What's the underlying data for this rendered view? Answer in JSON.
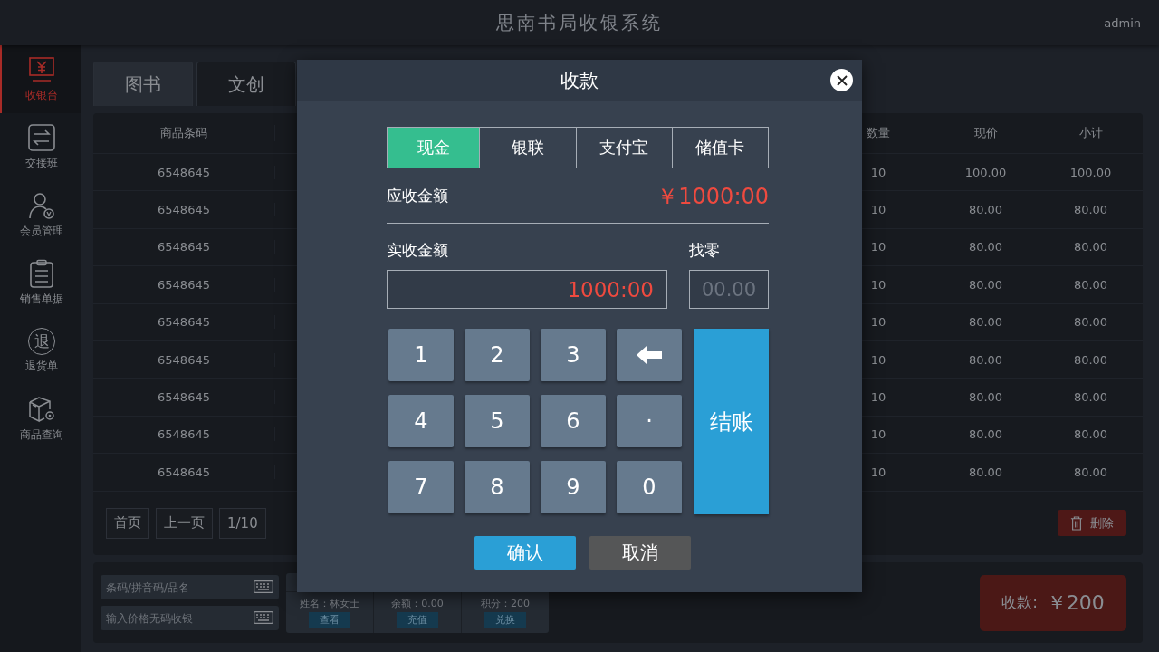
{
  "header": {
    "title": "思南书局收银系统",
    "user": "admin"
  },
  "sidebar": {
    "items": [
      {
        "label": "收银台",
        "selected": true
      },
      {
        "label": "交接班",
        "selected": false
      },
      {
        "label": "会员管理",
        "selected": false
      },
      {
        "label": "销售单据",
        "selected": false
      },
      {
        "label": "退货单",
        "icon_text": "退",
        "selected": false
      },
      {
        "label": "商品查询",
        "selected": false
      }
    ]
  },
  "category_tabs": [
    {
      "label": "图书",
      "selected": true
    },
    {
      "label": "文创",
      "selected": false
    }
  ],
  "table": {
    "columns": [
      "商品条码",
      "数量",
      "现价",
      "小计"
    ],
    "rows": [
      [
        "6548645",
        "10",
        "100.00",
        "100.00"
      ],
      [
        "6548645",
        "10",
        "80.00",
        "80.00"
      ],
      [
        "6548645",
        "10",
        "80.00",
        "80.00"
      ],
      [
        "6548645",
        "10",
        "80.00",
        "80.00"
      ],
      [
        "6548645",
        "10",
        "80.00",
        "80.00"
      ],
      [
        "6548645",
        "10",
        "80.00",
        "80.00"
      ],
      [
        "6548645",
        "10",
        "80.00",
        "80.00"
      ],
      [
        "6548645",
        "10",
        "80.00",
        "80.00"
      ],
      [
        "6548645",
        "10",
        "80.00",
        "80.00"
      ]
    ]
  },
  "pagination": [
    "首页",
    "上一页",
    "1/10"
  ],
  "delete_button": "删除",
  "search_fields": [
    {
      "placeholder": "条码/拼音码/品名"
    },
    {
      "placeholder": "输入价格无码收银"
    }
  ],
  "member": [
    {
      "text": "姓名：林女士",
      "action": "查看"
    },
    {
      "text": "余额：0.00",
      "action": "充值"
    },
    {
      "text": "积分：200",
      "action": "兑换"
    }
  ],
  "checkout_button": {
    "label": "收款:",
    "amount": "￥200"
  },
  "dialog": {
    "title": "收款",
    "payment_tabs": [
      {
        "label": "现金",
        "selected": true
      },
      {
        "label": "银联",
        "selected": false
      },
      {
        "label": "支付宝",
        "selected": false
      },
      {
        "label": "储值卡",
        "selected": false
      }
    ],
    "due_label": "应收金额",
    "due_amount": "￥1000:00",
    "received_label": "实收金额",
    "received_value": "1000:00",
    "change_label": "找零",
    "change_placeholder": "00.00",
    "keys": [
      {
        "kind": "digit",
        "label": "1"
      },
      {
        "kind": "digit",
        "label": "2"
      },
      {
        "kind": "digit",
        "label": "3"
      },
      {
        "kind": "backspace"
      },
      {
        "kind": "digit",
        "label": "4"
      },
      {
        "kind": "digit",
        "label": "5"
      },
      {
        "kind": "digit",
        "label": "6"
      },
      {
        "kind": "digit",
        "label": "·"
      },
      {
        "kind": "digit",
        "label": "7"
      },
      {
        "kind": "digit",
        "label": "8"
      },
      {
        "kind": "digit",
        "label": "9"
      },
      {
        "kind": "digit",
        "label": "0"
      }
    ],
    "settle_button": "结账",
    "confirm_button": "确认",
    "cancel_button": "取消"
  }
}
